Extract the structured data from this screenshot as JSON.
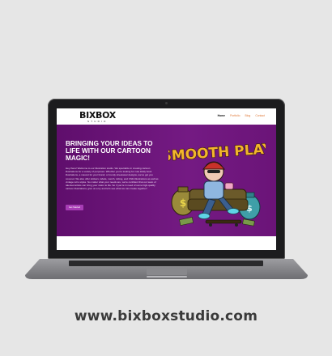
{
  "site": {
    "logo_main": "BIXBOX",
    "logo_sub": "STUDIO",
    "nav": [
      "Home",
      "Portfolio",
      "Blog",
      "Contact"
    ],
    "hero_title": "BRINGING YOUR IDEAS TO LIFE WITH OUR CARTOON MAGIC!",
    "hero_text": "Hey there! Welcome to our illustration studio. We specialize in creating cartoon illustrations for a variety of purposes. Whether you're looking for cute kiddy book illustrations, a mascot for your brand, or trendy streetwear designs, we've got you covered. We also offer stickers, labels, merch, tubing, and Chibi illustrations as well as vintage retro styles. No matter what your needs are, we're confident that our team of talented artists can bring your vision to life. So if you're in need of some high-quality cartoon illustrations, give us a try and let's see what we can create together!",
    "cta_label": "Get Started",
    "artwork_text": "SMOOTH PLAY"
  },
  "url": "www.bixboxstudio.com",
  "colors": {
    "page_bg": "#e6e6e6",
    "hero_purple": "#6b1478",
    "cta": "#a73db5",
    "nav_accent": "#e07a3a"
  }
}
